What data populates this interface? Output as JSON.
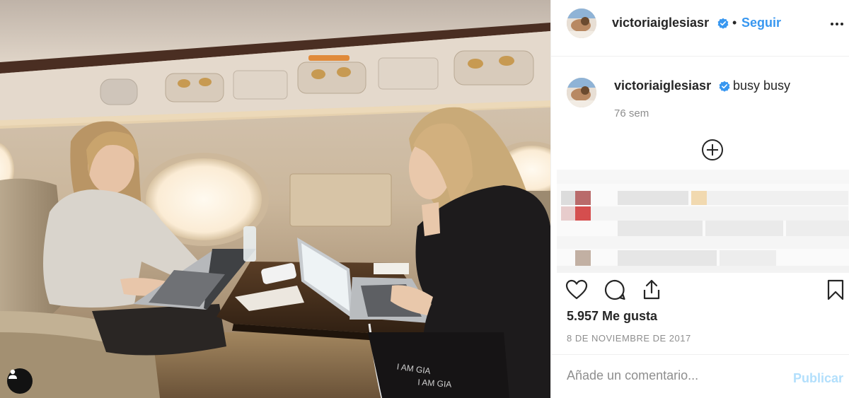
{
  "post": {
    "image_description_icon": "photo-icon",
    "user_tag_icon": "user-icon"
  },
  "header": {
    "username": "victoriaiglesiasr",
    "separator": "•",
    "follow_label": "Seguir",
    "verified_icon": "verified-badge-icon",
    "more_icon": "more-options-icon"
  },
  "caption": {
    "username": "victoriaiglesiasr",
    "text": "busy busy",
    "time": "76 sem",
    "load_more_icon": "plus-circle-icon"
  },
  "actions": {
    "like_icon": "heart-icon",
    "comment_icon": "comment-icon",
    "share_icon": "share-icon",
    "save_icon": "bookmark-icon"
  },
  "likes": "5.957 Me gusta",
  "date": "8 DE NOVIEMBRE DE 2017",
  "comment": {
    "placeholder": "Añade un comentario...",
    "publish_label": "Publicar"
  },
  "colors": {
    "link": "#3897f0",
    "publish_disabled": "#b2dffc",
    "verified": "#3897f0",
    "text": "#262626",
    "muted": "#8e8e8e"
  }
}
